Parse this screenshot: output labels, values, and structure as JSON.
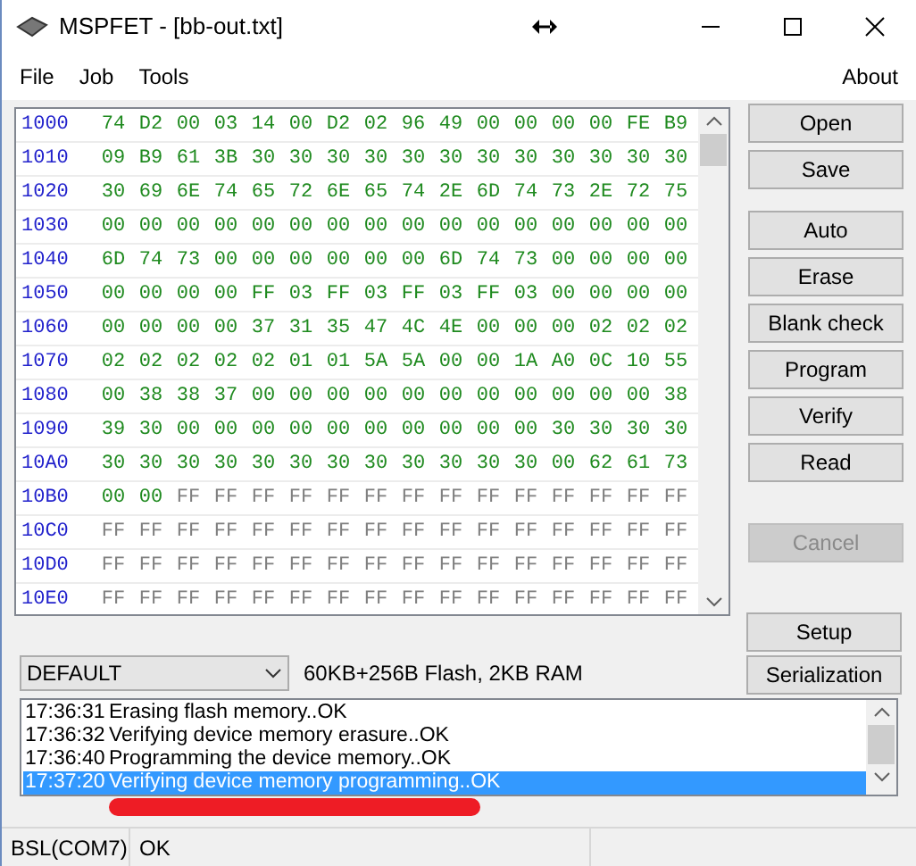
{
  "window": {
    "title": "MSPFET - [bb-out.txt]"
  },
  "menu": {
    "left": [
      {
        "label": "File"
      },
      {
        "label": "Job"
      },
      {
        "label": "Tools"
      }
    ],
    "right": [
      {
        "label": "About"
      }
    ]
  },
  "hex_rows": [
    {
      "address": "1000",
      "bytes": [
        "74",
        "D2",
        "00",
        "03",
        "14",
        "00",
        "D2",
        "02",
        "96",
        "49",
        "00",
        "00",
        "00",
        "00",
        "FE",
        "B9"
      ],
      "erased_bytes": []
    },
    {
      "address": "1010",
      "bytes": [
        "09",
        "B9",
        "61",
        "3B",
        "30",
        "30",
        "30",
        "30",
        "30",
        "30",
        "30",
        "30",
        "30",
        "30",
        "30",
        "30"
      ],
      "erased_bytes": []
    },
    {
      "address": "1020",
      "bytes": [
        "30",
        "69",
        "6E",
        "74",
        "65",
        "72",
        "6E",
        "65",
        "74",
        "2E",
        "6D",
        "74",
        "73",
        "2E",
        "72",
        "75"
      ],
      "erased_bytes": []
    },
    {
      "address": "1030",
      "bytes": [
        "00",
        "00",
        "00",
        "00",
        "00",
        "00",
        "00",
        "00",
        "00",
        "00",
        "00",
        "00",
        "00",
        "00",
        "00",
        "00"
      ],
      "erased_bytes": []
    },
    {
      "address": "1040",
      "bytes": [
        "6D",
        "74",
        "73",
        "00",
        "00",
        "00",
        "00",
        "00",
        "00",
        "6D",
        "74",
        "73",
        "00",
        "00",
        "00",
        "00"
      ],
      "erased_bytes": []
    },
    {
      "address": "1050",
      "bytes": [
        "00",
        "00",
        "00",
        "00",
        "FF",
        "03",
        "FF",
        "03",
        "FF",
        "03",
        "FF",
        "03",
        "00",
        "00",
        "00",
        "00"
      ],
      "erased_bytes": []
    },
    {
      "address": "1060",
      "bytes": [
        "00",
        "00",
        "00",
        "00",
        "37",
        "31",
        "35",
        "47",
        "4C",
        "4E",
        "00",
        "00",
        "00",
        "02",
        "02",
        "02"
      ],
      "erased_bytes": []
    },
    {
      "address": "1070",
      "bytes": [
        "02",
        "02",
        "02",
        "02",
        "02",
        "01",
        "01",
        "5A",
        "5A",
        "00",
        "00",
        "1A",
        "A0",
        "0C",
        "10",
        "55"
      ],
      "erased_bytes": []
    },
    {
      "address": "1080",
      "bytes": [
        "00",
        "38",
        "38",
        "37",
        "00",
        "00",
        "00",
        "00",
        "00",
        "00",
        "00",
        "00",
        "00",
        "00",
        "00",
        "38"
      ],
      "erased_bytes": []
    },
    {
      "address": "1090",
      "bytes": [
        "39",
        "30",
        "00",
        "00",
        "00",
        "00",
        "00",
        "00",
        "00",
        "00",
        "00",
        "00",
        "30",
        "30",
        "30",
        "30"
      ],
      "erased_bytes": []
    },
    {
      "address": "10A0",
      "bytes": [
        "30",
        "30",
        "30",
        "30",
        "30",
        "30",
        "30",
        "30",
        "30",
        "30",
        "30",
        "30",
        "00",
        "62",
        "61",
        "73"
      ],
      "erased_bytes": []
    },
    {
      "address": "10B0",
      "bytes": [
        "00",
        "00"
      ],
      "erased_bytes": [
        "FF",
        "FF",
        "FF",
        "FF",
        "FF",
        "FF",
        "FF",
        "FF",
        "FF",
        "FF",
        "FF",
        "FF",
        "FF",
        "FF"
      ]
    },
    {
      "address": "10C0",
      "bytes": [],
      "erased_bytes": [
        "FF",
        "FF",
        "FF",
        "FF",
        "FF",
        "FF",
        "FF",
        "FF",
        "FF",
        "FF",
        "FF",
        "FF",
        "FF",
        "FF",
        "FF",
        "FF"
      ]
    },
    {
      "address": "10D0",
      "bytes": [],
      "erased_bytes": [
        "FF",
        "FF",
        "FF",
        "FF",
        "FF",
        "FF",
        "FF",
        "FF",
        "FF",
        "FF",
        "FF",
        "FF",
        "FF",
        "FF",
        "FF",
        "FF"
      ]
    },
    {
      "address": "10E0",
      "bytes": [],
      "erased_bytes": [
        "FF",
        "FF",
        "FF",
        "FF",
        "FF",
        "FF",
        "FF",
        "FF",
        "FF",
        "FF",
        "FF",
        "FF",
        "FF",
        "FF",
        "FF",
        "FF"
      ]
    }
  ],
  "button_groups": [
    [
      {
        "label": "Open",
        "disabled": false
      },
      {
        "label": "Save",
        "disabled": false
      }
    ],
    [
      {
        "label": "Auto",
        "disabled": false
      },
      {
        "label": "Erase",
        "disabled": false
      },
      {
        "label": "Blank check",
        "disabled": false
      },
      {
        "label": "Program",
        "disabled": false
      },
      {
        "label": "Verify",
        "disabled": false
      },
      {
        "label": "Read",
        "disabled": false
      }
    ],
    [
      {
        "label": "Cancel",
        "disabled": true
      }
    ]
  ],
  "bottom_buttons": [
    {
      "label": "Setup",
      "disabled": false
    },
    {
      "label": "Serialization",
      "disabled": false
    }
  ],
  "device_select": {
    "value": "DEFAULT"
  },
  "device_info": "60KB+256B Flash, 2KB RAM",
  "log": [
    {
      "time": "17:36:31",
      "message": "Erasing flash memory..OK",
      "selected": false
    },
    {
      "time": "17:36:32",
      "message": "Verifying device memory erasure..OK",
      "selected": false
    },
    {
      "time": "17:36:40",
      "message": "Programming the device memory..OK",
      "selected": false
    },
    {
      "time": "17:37:20",
      "message": "Verifying device memory programming..OK",
      "selected": true
    }
  ],
  "status_bar": [
    {
      "text": "BSL(COM7)"
    },
    {
      "text": "OK"
    }
  ]
}
